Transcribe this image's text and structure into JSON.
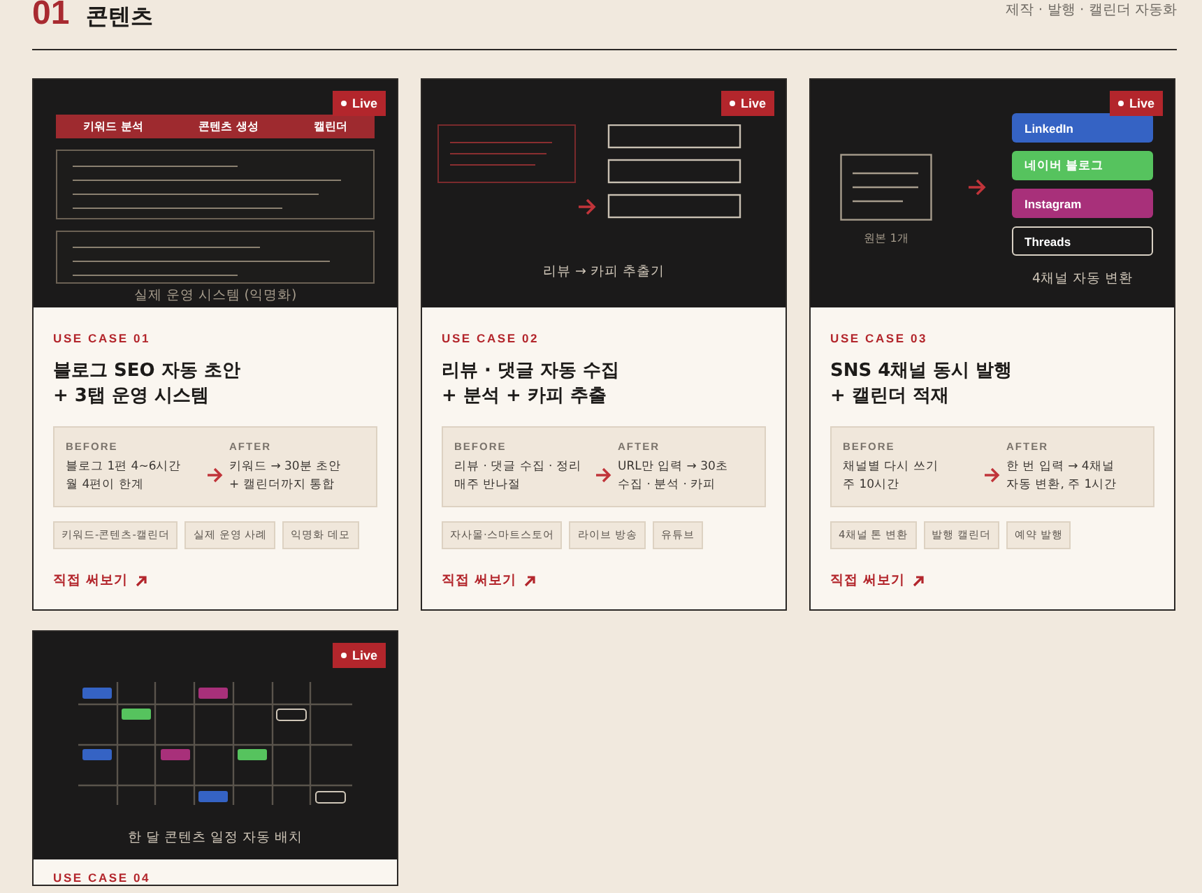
{
  "section": {
    "number": "01",
    "title": "콘텐츠",
    "subtitle": "제작 · 발행 · 캘린더 자동화"
  },
  "cards": [
    {
      "preview": {
        "kind": "tabs",
        "badge": "Live",
        "tabs": [
          "키워드 분석",
          "콘텐츠 생성",
          "캘린더"
        ],
        "caption": "실제 운영 시스템 (익명화)"
      },
      "eyebrow": "USE CASE 01",
      "title": [
        "블로그 SEO 자동 초안",
        "+ 3탭 운영 시스템"
      ],
      "before": {
        "label": "BEFORE",
        "lines": [
          "블로그 1편 4~6시간",
          "월 4편이 한계"
        ]
      },
      "after": {
        "label": "AFTER",
        "lines": [
          "키워드 → 30분 초안",
          "+ 캘린더까지 통합"
        ]
      },
      "tags": [
        "키워드-콘텐츠-캘린더",
        "실제 운영 사례",
        "익명화 데모"
      ],
      "link": "직접 써보기"
    },
    {
      "preview": {
        "kind": "review",
        "badge": "Live",
        "caption": "리뷰 → 카피 추출기"
      },
      "eyebrow": "USE CASE 02",
      "title": [
        "리뷰 · 댓글 자동 수집",
        "+ 분석 + 카피 추출"
      ],
      "before": {
        "label": "BEFORE",
        "lines": [
          "리뷰 · 댓글 수집 · 정리",
          "매주 반나절"
        ]
      },
      "after": {
        "label": "AFTER",
        "lines": [
          "URL만 입력 → 30초",
          "수집 · 분석 · 카피"
        ]
      },
      "tags": [
        "자사몰·스마트스토어",
        "라이브 방송",
        "유튜브"
      ],
      "link": "직접 써보기"
    },
    {
      "preview": {
        "kind": "channels",
        "badge": "Live",
        "source": "원본 1개",
        "channels": [
          {
            "label": "LinkedIn",
            "color": "#3563c4"
          },
          {
            "label": "네이버 블로그",
            "color": "#56c35e"
          },
          {
            "label": "Instagram",
            "color": "#a8307a"
          },
          {
            "label": "Threads",
            "color": "#1b1a1a"
          }
        ],
        "caption": "4채널 자동 변환"
      },
      "eyebrow": "USE CASE 03",
      "title": [
        "SNS 4채널 동시 발행",
        "+ 캘린더 적재"
      ],
      "before": {
        "label": "BEFORE",
        "lines": [
          "채널별 다시 쓰기",
          "주 10시간"
        ]
      },
      "after": {
        "label": "AFTER",
        "lines": [
          "한 번 입력 → 4채널",
          "자동 변환, 주 1시간"
        ]
      },
      "tags": [
        "4채널 톤 변환",
        "발행 캘린더",
        "예약 발행"
      ],
      "link": "직접 써보기"
    },
    {
      "preview": {
        "kind": "calendar",
        "badge": "Live",
        "caption": "한 달 콘텐츠 일정 자동 배치"
      },
      "eyebrow": "USE CASE 04"
    }
  ]
}
